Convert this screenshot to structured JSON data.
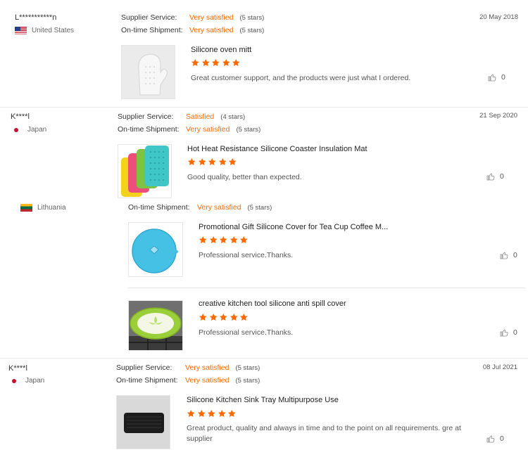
{
  "reviews": [
    {
      "buyer": "L***********n",
      "country": "United States",
      "flag_icon": "us-flag-icon",
      "date": "20 May 2018",
      "supplier_service": {
        "label": "Supplier Service:",
        "value": "Very satisfied",
        "stars": "(5 stars)"
      },
      "shipment": {
        "label": "On-time Shipment:",
        "value": "Very satisfied",
        "stars": "(5 stars)"
      },
      "products": [
        {
          "name": "Silicone oven mitt",
          "rating": 5,
          "comment": "Great customer support, and the products were just what I ordered.",
          "likes": "0"
        }
      ]
    },
    {
      "buyer": "K****l",
      "country": "Japan",
      "flag_icon": "japan-flag-icon",
      "date": "21 Sep 2020",
      "supplier_service": {
        "label": "Supplier Service:",
        "value": "Satisfied",
        "stars": "(4 stars)"
      },
      "shipment": {
        "label": "On-time Shipment:",
        "value": "Very satisfied",
        "stars": "(5 stars)"
      },
      "products": [
        {
          "name": "Hot Heat Resistance Silicone Coaster Insulation Mat",
          "rating": 5,
          "comment": "Good quality, better than expected.",
          "likes": "0"
        }
      ]
    },
    {
      "buyer": "",
      "country": "Lithuania",
      "flag_icon": "lithuania-flag-icon",
      "date": "",
      "shipment": {
        "label": "On-time Shipment:",
        "value": "Very satisfied",
        "stars": "(5 stars)"
      },
      "products": [
        {
          "name": "Promotional Gift Silicone Cover for Tea Cup Coffee M...",
          "rating": 5,
          "comment": "Professional service.Thanks.",
          "likes": "0"
        },
        {
          "name": "creative kitchen tool silicone anti spill cover",
          "rating": 5,
          "comment": "Professional service.Thanks.",
          "likes": "0"
        }
      ]
    },
    {
      "buyer": "K****l",
      "country": "Japan",
      "flag_icon": "japan-flag-icon",
      "date": "08 Jul 2021",
      "supplier_service": {
        "label": "Supplier Service:",
        "value": "Very satisfied",
        "stars": "(5 stars)"
      },
      "shipment": {
        "label": "On-time Shipment:",
        "value": "Very satisfied",
        "stars": "(5 stars)"
      },
      "products": [
        {
          "name": "Silicone Kitchen Sink Tray Multipurpose Use",
          "rating": 5,
          "comment": "Great product, quality and always in time and to the point on all requirements. gre at supplier",
          "likes": "0"
        }
      ]
    }
  ],
  "colors": {
    "accent": "#ff6a00",
    "star": "#ff6a00",
    "text": "#333333",
    "muted": "#666666",
    "divider": "#e8e8e8"
  }
}
